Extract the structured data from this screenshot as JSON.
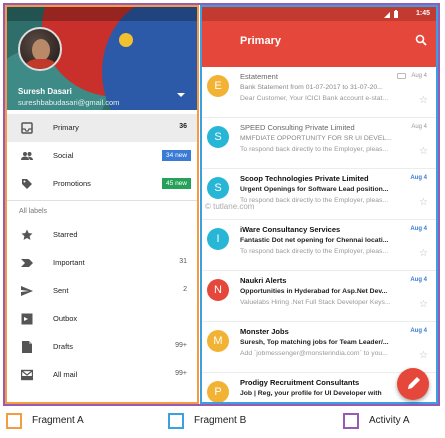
{
  "colors": {
    "activity_border": "#9b59b6",
    "fragment_a_border": "#f39c42",
    "fragment_b_border": "#3aa0e0",
    "appbar": "#e5483b",
    "social_badge": "#3a7bd5",
    "promotions_badge": "#27a15a"
  },
  "drawer": {
    "user_name": "Suresh Dasari",
    "user_email": "sureshbabudasari@gmail.com",
    "items": [
      {
        "label": "Primary",
        "count": "36",
        "icon": "inbox-icon"
      },
      {
        "label": "Social",
        "badge": "34 new",
        "icon": "people-icon"
      },
      {
        "label": "Promotions",
        "badge": "45 new",
        "icon": "tag-icon"
      }
    ],
    "all_labels_heading": "All labels",
    "labels": [
      {
        "label": "Starred",
        "count": "",
        "icon": "star-icon"
      },
      {
        "label": "Important",
        "count": "31",
        "icon": "important-icon"
      },
      {
        "label": "Sent",
        "count": "2",
        "icon": "send-icon"
      },
      {
        "label": "Outbox",
        "count": "",
        "icon": "outbox-icon"
      },
      {
        "label": "Drafts",
        "count": "99+",
        "icon": "draft-icon"
      },
      {
        "label": "All mail",
        "count": "99+",
        "icon": "all-mail-icon"
      }
    ]
  },
  "inbox": {
    "status_time": "1:45",
    "title": "Primary",
    "emails": [
      {
        "initial": "E",
        "color": "#f2b233",
        "sender": "Estatement",
        "date": "Aug 4",
        "subject": "Bank Statement from 01-07-2017 to 31-07-20...",
        "preview": "Dear Customer, Your ICICI Bank account e-stat...",
        "state": "read"
      },
      {
        "initial": "S",
        "color": "#28b6d6",
        "sender": "SPEED Consulting Private Limited",
        "date": "Aug 4",
        "subject": "MMFDIATE OPPORTUNITY FOR SR UI DEVEL...",
        "preview": "To respond back directly to the Employer, pleas...",
        "state": "read"
      },
      {
        "initial": "S",
        "color": "#28b6d6",
        "sender": "Scoop Technologies Private Limited",
        "date": "Aug 4",
        "subject": "Urgent Openings for Software Lead position...",
        "preview": "To respond back directly to the Employer, pleas...",
        "state": "unread"
      },
      {
        "initial": "I",
        "color": "#28b6d6",
        "sender": "iWare Consultancy Services",
        "date": "Aug 4",
        "subject": "Fantastic Dot net opening for Chennai locati...",
        "preview": "To respond back directly to the Employer, pleas...",
        "state": "unread"
      },
      {
        "initial": "N",
        "color": "#e5483b",
        "sender": "Naukri Alerts",
        "date": "Aug 4",
        "subject": "Opportunities in Hyderabad for Asp.Net Dev...",
        "preview": "Valuelabs Hiring .Net Full Stack Developer Keys...",
        "state": "unread"
      },
      {
        "initial": "M",
        "color": "#f2b233",
        "sender": "Monster Jobs",
        "date": "Aug 4",
        "subject": "Suresh, Top matching jobs for Team Leader/...",
        "preview": "Add `jobmessenger@monsterindia.com` to you...",
        "state": "unread"
      },
      {
        "initial": "P",
        "color": "#f2b233",
        "sender": "Prodigy Recruitment Consultants",
        "date": "",
        "subject": "Job | Reg, your profile for UI Developer with",
        "preview": "",
        "state": "unread"
      }
    ]
  },
  "watermark": "© tutlane.com",
  "legend": [
    {
      "label": "Fragment A",
      "color": "#f39c42"
    },
    {
      "label": "Fragment B",
      "color": "#3aa0e0"
    },
    {
      "label": "Activity A",
      "color": "#9b59b6"
    }
  ]
}
